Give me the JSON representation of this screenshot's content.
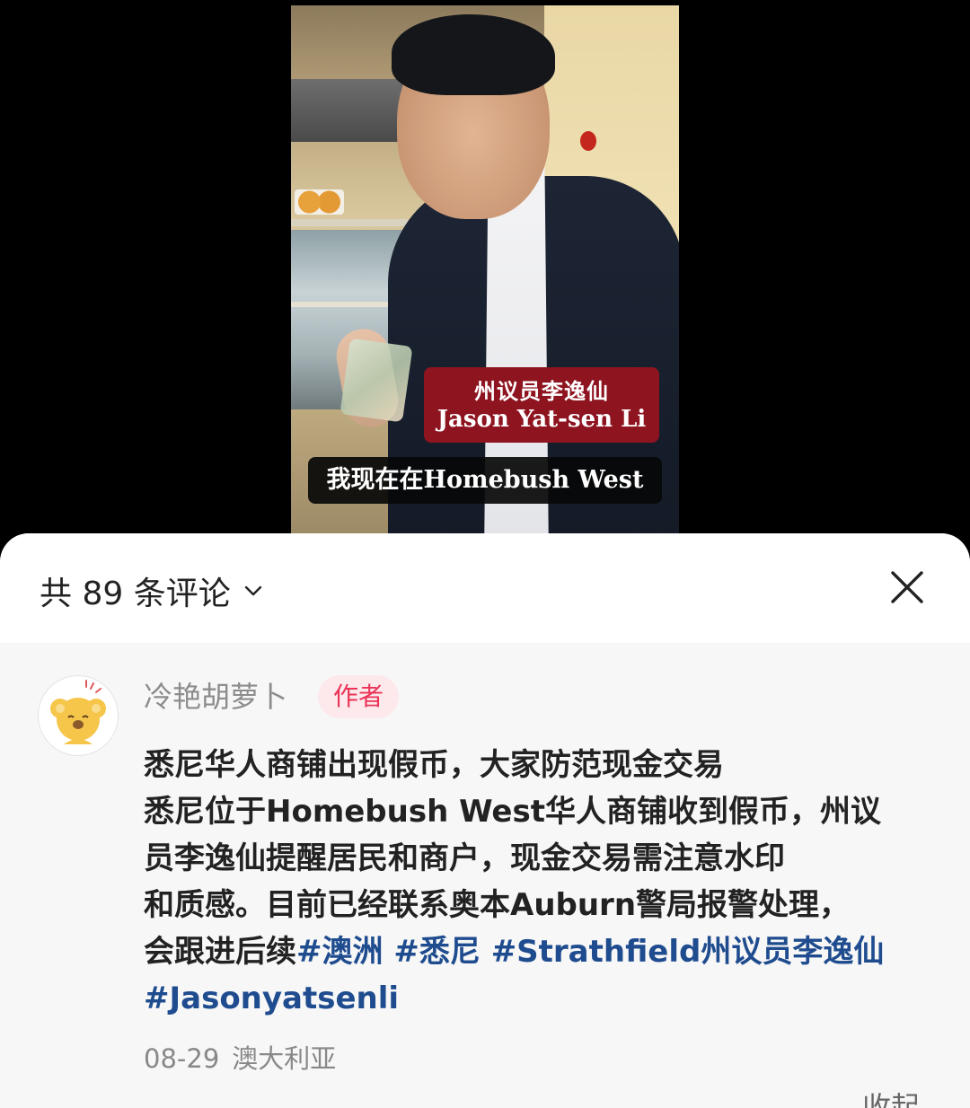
{
  "video": {
    "name_card_line1": "州议员李逸仙",
    "name_card_line2": "Jason Yat-sen Li",
    "subtitle": "我现在在Homebush West"
  },
  "header": {
    "comment_count_label": "共 89 条评论",
    "dropdown_icon": "chevron-down-icon",
    "close_icon": "close-icon"
  },
  "comment": {
    "username": "冷艳胡萝卜",
    "badge": "作者",
    "avatar_icon": "koala-avatar",
    "lines": [
      "悉尼华人商铺出现假币，大家防范现金交易",
      "悉尼位于Homebush West华人商铺收到假币，州议",
      "员李逸仙提醒居民和商户，现金交易需注意水印",
      "和质感。目前已经联系奥本Auburn警局报警处理，"
    ],
    "line5_text": "会跟进后续",
    "tags": [
      "#澳洲",
      "#悉尼",
      "#Strathfield州议员李逸仙"
    ],
    "tag_last": "#Jasonyatsenli",
    "date": "08-29",
    "location": "澳大利亚",
    "collapse_label": "收起"
  },
  "colors": {
    "tag": "#1f4c8f",
    "badge_text": "#ea3357",
    "badge_bg": "#fde8eb"
  }
}
